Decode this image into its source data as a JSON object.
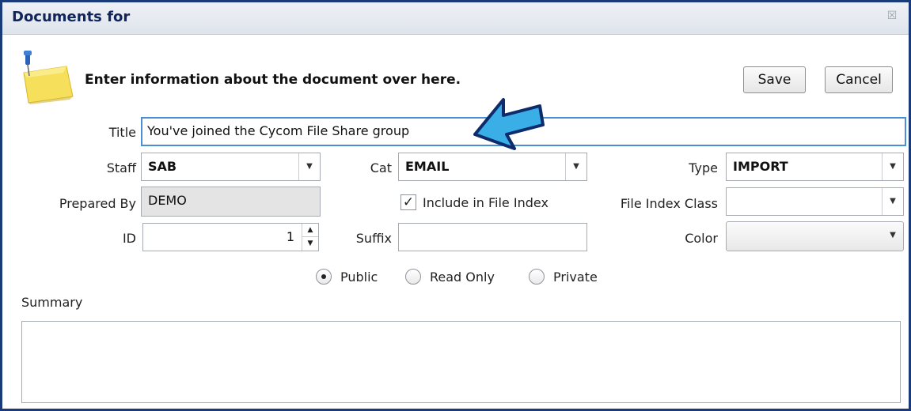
{
  "window": {
    "title": "Documents for",
    "close_icon": "close-icon"
  },
  "header": {
    "icon": "sticky-note-pin-icon",
    "instruction": "Enter information about the document over here."
  },
  "buttons": {
    "save": "Save",
    "cancel": "Cancel"
  },
  "form": {
    "title": {
      "label": "Title",
      "value": "You've joined the Cycom File Share group"
    },
    "staff": {
      "label": "Staff",
      "value": "SAB"
    },
    "cat": {
      "label": "Cat",
      "value": "EMAIL"
    },
    "type": {
      "label": "Type",
      "value": "IMPORT"
    },
    "prepared_by": {
      "label": "Prepared By",
      "value": "DEMO"
    },
    "include_in_file_index": {
      "label": "Include in File Index",
      "checked": true
    },
    "file_index_class": {
      "label": "File Index Class",
      "value": ""
    },
    "id": {
      "label": "ID",
      "value": "1"
    },
    "suffix": {
      "label": "Suffix",
      "value": ""
    },
    "color": {
      "label": "Color",
      "value": ""
    },
    "visibility": {
      "options": [
        "Public",
        "Read Only",
        "Private"
      ],
      "selected": "Public"
    },
    "summary": {
      "label": "Summary",
      "value": ""
    }
  },
  "annotation": {
    "icon": "blue-arrow-pointer-icon",
    "color": "#3aaee6"
  },
  "colors": {
    "title_bar_text": "#10265a",
    "window_border": "#1a3b7a",
    "focus_border": "#4a8fd6"
  }
}
